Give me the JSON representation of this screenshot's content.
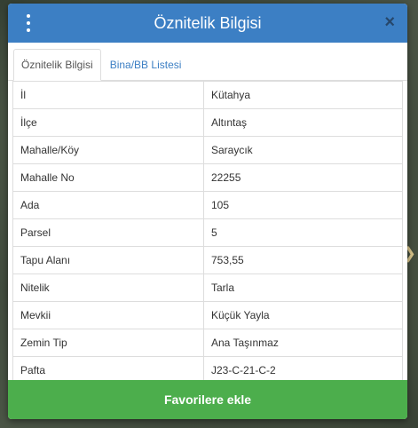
{
  "modal": {
    "title": "Öznitelik Bilgisi",
    "menu_icon": "vertical-dots-icon",
    "close_icon": "close-icon",
    "close_glyph": "×"
  },
  "tabs": [
    {
      "label": "Öznitelik Bilgisi",
      "active": true
    },
    {
      "label": "Bina/BB Listesi",
      "active": false
    }
  ],
  "attributes": [
    {
      "key": "İl",
      "value": "Kütahya"
    },
    {
      "key": "İlçe",
      "value": "Altıntaş"
    },
    {
      "key": "Mahalle/Köy",
      "value": "Saraycık"
    },
    {
      "key": "Mahalle No",
      "value": "22255"
    },
    {
      "key": "Ada",
      "value": "105"
    },
    {
      "key": "Parsel",
      "value": "5"
    },
    {
      "key": "Tapu Alanı",
      "value": "753,55"
    },
    {
      "key": "Nitelik",
      "value": "Tarla"
    },
    {
      "key": "Mevkii",
      "value": "Küçük Yayla"
    },
    {
      "key": "Zemin Tip",
      "value": "Ana Taşınmaz"
    },
    {
      "key": "Pafta",
      "value": "J23-C-21-C-2"
    }
  ],
  "footer": {
    "button_label": "Favorilere ekle"
  },
  "colors": {
    "header": "#3c7fc4",
    "footer_button": "#4cae4c",
    "tab_link": "#3c7fc4"
  }
}
